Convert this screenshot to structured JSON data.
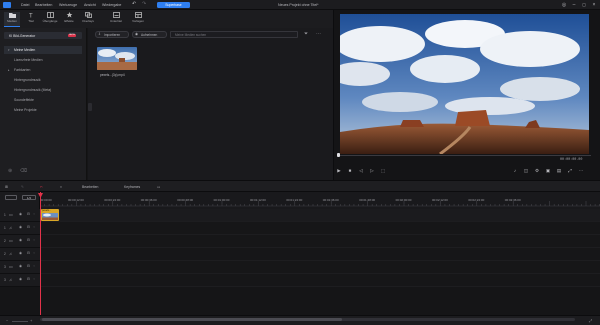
{
  "menu": {
    "items": [
      "Datei",
      "Bearbeiten",
      "Werkzeuge",
      "Ansicht",
      "Wiedergabe"
    ],
    "upgrade_label": "Superbase",
    "doc_title": "Neues Projekt ohne Titel*"
  },
  "toolbar": {
    "tabs": [
      {
        "label": "Medien",
        "icon": "folder-icon"
      },
      {
        "label": "Titel",
        "icon": "title-icon"
      },
      {
        "label": "Übergänge",
        "icon": "transition-icon"
      },
      {
        "label": "Effekte",
        "icon": "effects-icon"
      },
      {
        "label": "Overlays",
        "icon": "overlay-icon"
      },
      {
        "label": "Untertitel",
        "icon": "subtitle-icon"
      },
      {
        "label": "Vorlagen",
        "icon": "template-icon"
      }
    ]
  },
  "sidebar": {
    "ai_generator": "KI Bild-Generator",
    "ai_badge": "BETA",
    "items": [
      {
        "label": "Meine Medien",
        "caret": "▾",
        "selected": true
      },
      {
        "label": "Lizenzfreie Medien",
        "caret": "",
        "selected": false
      },
      {
        "label": "Farbkarten",
        "caret": "▸",
        "selected": false
      },
      {
        "label": "Hintergrundmusik",
        "caret": "",
        "selected": false
      },
      {
        "label": "Hintergrundmusik (Meta)",
        "caret": "",
        "selected": false
      },
      {
        "label": "Soundeffekte",
        "caret": "",
        "selected": false
      },
      {
        "label": "Meine Projekte",
        "caret": "",
        "selected": false
      }
    ]
  },
  "media": {
    "import_label": "Importieren",
    "record_label": "Aufnehmen",
    "search_placeholder": "Meine Medien suchen",
    "file_name": "pexels...(3p).mp4"
  },
  "preview": {
    "timecode": "00:00:00.00"
  },
  "timeline_toolbar": {
    "edit_label": "Bearbeiten",
    "keyframe_label": "Keyframes"
  },
  "timeline": {
    "zoom_label": "1/4",
    "ticks": [
      "00:00:00",
      "00:00:12:00",
      "00:00:24:00",
      "00:00:36:00",
      "00:00:48:00",
      "00:01:00:00",
      "00:01:12:00",
      "00:01:24:00",
      "00:01:36:00",
      "00:01:48:00",
      "00:02:00:00",
      "00:02:12:00",
      "00:02:24:00",
      "00:02:36:00"
    ],
    "tracks": [
      {
        "num": "1",
        "icon": "video-track-icon"
      },
      {
        "num": "1",
        "icon": "music-track-icon"
      },
      {
        "num": "2",
        "icon": "video-track-icon"
      },
      {
        "num": "2",
        "icon": "music-track-icon"
      },
      {
        "num": "3",
        "icon": "video-track-icon"
      },
      {
        "num": "3",
        "icon": "music-track-icon"
      }
    ],
    "clip_label": "pexels..."
  },
  "colors": {
    "accent": "#2f7ff0",
    "playhead": "#e2324a",
    "clip": "#d9a727"
  }
}
